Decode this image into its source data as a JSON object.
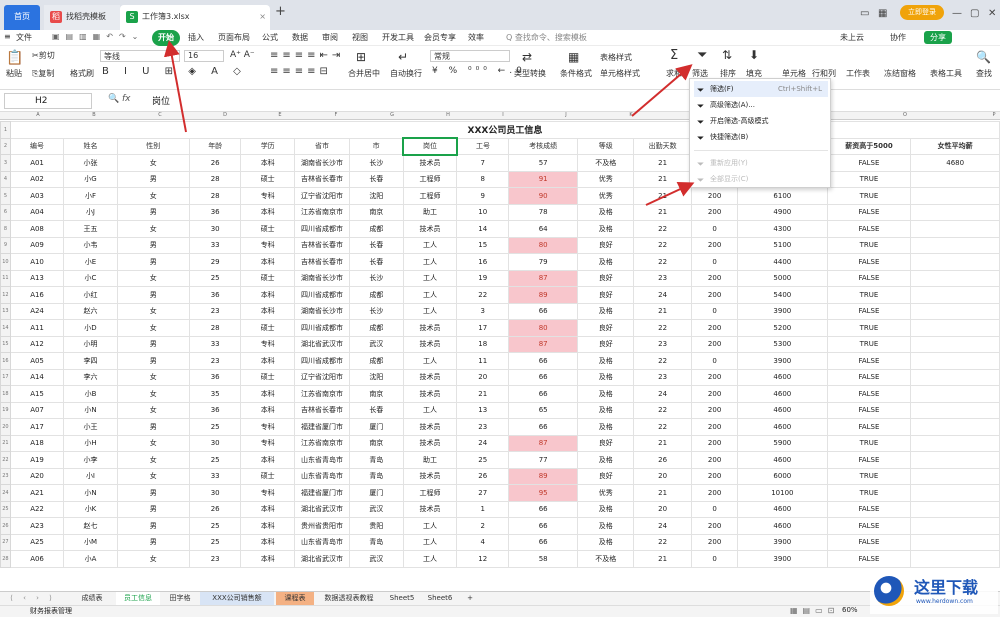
{
  "tabs": {
    "home": "首页",
    "template": "找稻壳模板",
    "workbook": "工作簿3.xlsx"
  },
  "topright": {
    "login": "立即登录"
  },
  "menu": {
    "file": "文件",
    "items": [
      "开始",
      "插入",
      "页面布局",
      "公式",
      "数据",
      "审阅",
      "视图",
      "开发工具",
      "会员专享",
      "效率"
    ],
    "search": "Q 查找命令、搜索模板",
    "unsaved": "未上云",
    "collab": "协作",
    "share": "分享"
  },
  "ribbon": {
    "paste": "粘贴",
    "cut": "剪切",
    "copy": "复制",
    "format_painter": "格式刷",
    "font": "等线",
    "size": "16",
    "merge": "合并居中",
    "wrap": "自动换行",
    "numfmt": "常规",
    "convert": "类型转换",
    "cond": "条件格式",
    "table_style": "表格样式",
    "cell_style": "单元格样式",
    "sum": "求和",
    "filter": "筛选",
    "sort": "排序",
    "fill": "填充",
    "cell": "单元格",
    "rowcol": "行和列",
    "sheet": "工作表",
    "freeze": "冻结窗格",
    "tools": "表格工具",
    "find": "查找"
  },
  "formula": {
    "cellref": "H2",
    "fx": "fx",
    "value": "岗位"
  },
  "columns": [
    "A",
    "B",
    "C",
    "D",
    "E",
    "F",
    "G",
    "H",
    "I",
    "J",
    "K",
    "L",
    "M",
    "N",
    "O",
    "P"
  ],
  "sheet": {
    "title": "XXX公司员工信息",
    "headers": [
      "编号",
      "姓名",
      "性别",
      "年龄",
      "学历",
      "省市",
      "市",
      "岗位",
      "工号",
      "考核成绩",
      "等级",
      "出勤天数",
      "",
      "",
      "薪资高于5000",
      "女性平均薪"
    ],
    "p3": "4680",
    "rows": [
      {
        "r": "3",
        "c": [
          "A01",
          "小张",
          "女",
          "26",
          "本科",
          "湖南省长沙市",
          "长沙",
          "技术员",
          "7",
          "57",
          "不及格",
          "21",
          "",
          "",
          "FALSE",
          ""
        ]
      },
      {
        "r": "4",
        "c": [
          "A02",
          "小G",
          "男",
          "28",
          "硕士",
          "吉林省长春市",
          "长春",
          "工程师",
          "8",
          "91",
          "优秀",
          "21",
          "",
          "",
          "TRUE",
          ""
        ]
      },
      {
        "r": "5",
        "c": [
          "A03",
          "小F",
          "女",
          "28",
          "专科",
          "辽宁省沈阳市",
          "沈阳",
          "工程师",
          "9",
          "90",
          "优秀",
          "21",
          "200",
          "6100",
          "TRUE",
          ""
        ]
      },
      {
        "r": "6",
        "c": [
          "A04",
          "小J",
          "男",
          "36",
          "本科",
          "江苏省南京市",
          "南京",
          "助工",
          "10",
          "78",
          "及格",
          "21",
          "200",
          "4900",
          "FALSE",
          ""
        ]
      },
      {
        "r": "8",
        "c": [
          "A08",
          "王五",
          "女",
          "30",
          "硕士",
          "四川省成都市",
          "成都",
          "技术员",
          "14",
          "64",
          "及格",
          "22",
          "0",
          "4300",
          "FALSE",
          ""
        ]
      },
      {
        "r": "9",
        "c": [
          "A09",
          "小韦",
          "男",
          "33",
          "专科",
          "吉林省长春市",
          "长春",
          "工人",
          "15",
          "80",
          "良好",
          "22",
          "200",
          "5100",
          "TRUE",
          ""
        ]
      },
      {
        "r": "10",
        "c": [
          "A10",
          "小E",
          "男",
          "29",
          "本科",
          "吉林省长春市",
          "长春",
          "工人",
          "16",
          "79",
          "及格",
          "22",
          "0",
          "4400",
          "FALSE",
          ""
        ]
      },
      {
        "r": "11",
        "c": [
          "A13",
          "小C",
          "女",
          "25",
          "硕士",
          "湖南省长沙市",
          "长沙",
          "工人",
          "19",
          "87",
          "良好",
          "23",
          "200",
          "5000",
          "FALSE",
          ""
        ]
      },
      {
        "r": "12",
        "c": [
          "A16",
          "小红",
          "男",
          "36",
          "本科",
          "四川省成都市",
          "成都",
          "工人",
          "22",
          "89",
          "良好",
          "24",
          "200",
          "5400",
          "TRUE",
          ""
        ]
      },
      {
        "r": "13",
        "c": [
          "A24",
          "赵六",
          "女",
          "23",
          "本科",
          "湖南省长沙市",
          "长沙",
          "工人",
          "3",
          "66",
          "及格",
          "21",
          "0",
          "3900",
          "FALSE",
          ""
        ]
      },
      {
        "r": "14",
        "c": [
          "A11",
          "小D",
          "女",
          "28",
          "硕士",
          "四川省成都市",
          "成都",
          "技术员",
          "17",
          "80",
          "良好",
          "22",
          "200",
          "5200",
          "TRUE",
          ""
        ]
      },
      {
        "r": "15",
        "c": [
          "A12",
          "小明",
          "男",
          "33",
          "专科",
          "湖北省武汉市",
          "武汉",
          "技术员",
          "18",
          "87",
          "良好",
          "23",
          "200",
          "5300",
          "TRUE",
          ""
        ]
      },
      {
        "r": "16",
        "c": [
          "A05",
          "李四",
          "男",
          "23",
          "本科",
          "四川省成都市",
          "成都",
          "工人",
          "11",
          "66",
          "及格",
          "22",
          "0",
          "3900",
          "FALSE",
          ""
        ]
      },
      {
        "r": "17",
        "c": [
          "A14",
          "李六",
          "女",
          "36",
          "硕士",
          "辽宁省沈阳市",
          "沈阳",
          "技术员",
          "20",
          "66",
          "及格",
          "23",
          "200",
          "4600",
          "FALSE",
          ""
        ]
      },
      {
        "r": "18",
        "c": [
          "A15",
          "小B",
          "女",
          "35",
          "本科",
          "江苏省南京市",
          "南京",
          "技术员",
          "21",
          "66",
          "及格",
          "24",
          "200",
          "4600",
          "FALSE",
          ""
        ]
      },
      {
        "r": "19",
        "c": [
          "A07",
          "小N",
          "女",
          "36",
          "本科",
          "吉林省长春市",
          "长春",
          "工人",
          "13",
          "65",
          "及格",
          "22",
          "200",
          "4600",
          "FALSE",
          ""
        ]
      },
      {
        "r": "20",
        "c": [
          "A17",
          "小王",
          "男",
          "25",
          "专科",
          "福建省厦门市",
          "厦门",
          "技术员",
          "23",
          "66",
          "及格",
          "22",
          "200",
          "4600",
          "FALSE",
          ""
        ]
      },
      {
        "r": "21",
        "c": [
          "A18",
          "小H",
          "女",
          "30",
          "专科",
          "江苏省南京市",
          "南京",
          "技术员",
          "24",
          "87",
          "良好",
          "21",
          "200",
          "5900",
          "TRUE",
          ""
        ]
      },
      {
        "r": "22",
        "c": [
          "A19",
          "小李",
          "女",
          "25",
          "本科",
          "山东省青岛市",
          "青岛",
          "助工",
          "25",
          "77",
          "及格",
          "26",
          "200",
          "4600",
          "FALSE",
          ""
        ]
      },
      {
        "r": "23",
        "c": [
          "A20",
          "小I",
          "女",
          "33",
          "硕士",
          "山东省青岛市",
          "青岛",
          "技术员",
          "26",
          "89",
          "良好",
          "20",
          "200",
          "6000",
          "TRUE",
          ""
        ]
      },
      {
        "r": "24",
        "c": [
          "A21",
          "小N",
          "男",
          "30",
          "专科",
          "福建省厦门市",
          "厦门",
          "工程师",
          "27",
          "95",
          "优秀",
          "21",
          "200",
          "10100",
          "TRUE",
          ""
        ]
      },
      {
        "r": "25",
        "c": [
          "A22",
          "小K",
          "男",
          "26",
          "本科",
          "湖北省武汉市",
          "武汉",
          "技术员",
          "1",
          "66",
          "及格",
          "20",
          "0",
          "4600",
          "FALSE",
          ""
        ]
      },
      {
        "r": "26",
        "c": [
          "A23",
          "赵七",
          "男",
          "25",
          "本科",
          "贵州省贵阳市",
          "贵阳",
          "工人",
          "2",
          "66",
          "及格",
          "24",
          "200",
          "4600",
          "FALSE",
          ""
        ]
      },
      {
        "r": "27",
        "c": [
          "A25",
          "小M",
          "男",
          "25",
          "本科",
          "山东省青岛市",
          "青岛",
          "工人",
          "4",
          "66",
          "及格",
          "22",
          "200",
          "3900",
          "FALSE",
          ""
        ]
      },
      {
        "r": "28",
        "c": [
          "A06",
          "小A",
          "女",
          "23",
          "本科",
          "湖北省武汉市",
          "武汉",
          "工人",
          "12",
          "58",
          "不及格",
          "21",
          "0",
          "3900",
          "FALSE",
          ""
        ]
      }
    ],
    "pink_scores": [
      "91",
      "90",
      "80",
      "87",
      "89",
      "95"
    ]
  },
  "dropdown": [
    {
      "label": "筛选(F)",
      "key": "Ctrl+Shift+L",
      "enabled": true,
      "icon": "filter-icon"
    },
    {
      "label": "高级筛选(A)...",
      "key": "",
      "enabled": true,
      "icon": "advanced-filter-icon"
    },
    {
      "label": "开启筛选-高级模式",
      "key": "",
      "enabled": true,
      "icon": "filter-mode-icon"
    },
    {
      "label": "快捷筛选(B)",
      "key": "",
      "enabled": true,
      "icon": "quick-filter-icon"
    },
    {
      "label": "重新应用(Y)",
      "key": "",
      "enabled": false,
      "icon": "reapply-icon"
    },
    {
      "label": "全部显示(C)",
      "key": "",
      "enabled": false,
      "icon": "show-all-icon"
    }
  ],
  "sheettabs": [
    "成绩表",
    "员工信息",
    "田字格",
    "XXX公司销售额",
    "课程表",
    "数据透视表教程",
    "Sheet5",
    "Sheet6"
  ],
  "active_sheet": "员工信息",
  "status": {
    "left": "财务报表管理",
    "zoom": "60%"
  },
  "watermark": {
    "cn": "这里下载",
    "url": "www.herdown.com"
  },
  "colors": {
    "accent_green": "#1aa24a",
    "pink_fill": "#f8c6cc",
    "arrow_red": "#d22d2d",
    "home_blue": "#2b73e0"
  }
}
